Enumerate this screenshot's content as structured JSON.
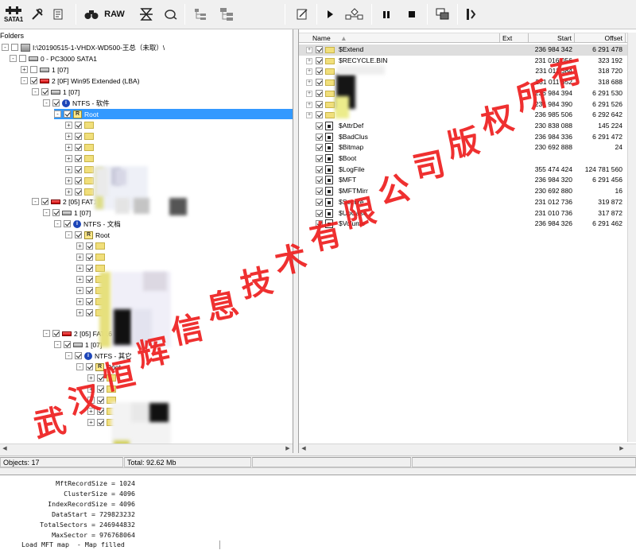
{
  "toolbar": {
    "sata_label": "SATA1",
    "raw_label": "RAW"
  },
  "left": {
    "title": "Folders",
    "tree": [
      {
        "label": "I:\\20190515-1-VHDX-WD500-王总（未取）\\",
        "icon": "pc"
      },
      {
        "label": "0 - PC3000 SATA1",
        "icon": "disk"
      },
      {
        "label": "1 [07]",
        "icon": "disk"
      },
      {
        "label": "2 [0F] Win95 Extended  (LBA)",
        "icon": "part"
      },
      {
        "label": "1 [07]",
        "icon": "disk"
      },
      {
        "label": "NTFS - 软件",
        "icon": "ntfs"
      },
      {
        "label": "Root",
        "icon": "root"
      },
      {
        "label": "2 [05] FAT16 Extended",
        "icon": "part"
      },
      {
        "label": "1 [07]",
        "icon": "disk"
      },
      {
        "label": "NTFS - 文档",
        "icon": "ntfs"
      },
      {
        "label": "Root",
        "icon": "root"
      },
      {
        "label": "2 [05] FAT16 Extended",
        "icon": "part"
      },
      {
        "label": "1 [07]",
        "icon": "disk"
      },
      {
        "label": "NTFS - 其它",
        "icon": "ntfs"
      },
      {
        "label": "Root",
        "icon": "root"
      }
    ]
  },
  "right": {
    "columns": [
      "Name",
      "Ext",
      "Start",
      "Offset"
    ],
    "rows": [
      {
        "name": "$Extend",
        "start": "236 984 342",
        "offset": "6 291 478",
        "type": "folder"
      },
      {
        "name": "$RECYCLE.BIN",
        "start": "231 016 056",
        "offset": "323 192",
        "type": "folder"
      },
      {
        "name": "",
        "start": "231 011 584",
        "offset": "318 720",
        "type": "folder"
      },
      {
        "name": "",
        "start": "231 011 552",
        "offset": "318 688",
        "type": "folder"
      },
      {
        "name": "",
        "start": "236 984 394",
        "offset": "6 291 530",
        "type": "folder"
      },
      {
        "name": "",
        "start": "236 984 390",
        "offset": "6 291 526",
        "type": "folder"
      },
      {
        "name": "",
        "start": "236 985 506",
        "offset": "6 292 642",
        "type": "folder"
      },
      {
        "name": "$AttrDef",
        "start": "230 838 088",
        "offset": "145 224",
        "type": "file"
      },
      {
        "name": "$BadClus",
        "start": "236 984 336",
        "offset": "6 291 472",
        "type": "file"
      },
      {
        "name": "$Bitmap",
        "start": "230 692 888",
        "offset": "24",
        "type": "file"
      },
      {
        "name": "$Boot",
        "start": "",
        "offset": "",
        "type": "file"
      },
      {
        "name": "$LogFile",
        "start": "355 474 424",
        "offset": "124 781 560",
        "type": "file"
      },
      {
        "name": "$MFT",
        "start": "236 984 320",
        "offset": "6 291 456",
        "type": "file"
      },
      {
        "name": "$MFTMirr",
        "start": "230 692 880",
        "offset": "16",
        "type": "file"
      },
      {
        "name": "$Secure",
        "start": "231 012 736",
        "offset": "319 872",
        "type": "file"
      },
      {
        "name": "$UpCase",
        "start": "231 010 736",
        "offset": "317 872",
        "type": "file"
      },
      {
        "name": "$Volume",
        "start": "236 984 326",
        "offset": "6 291 462",
        "type": "file"
      }
    ]
  },
  "status": {
    "objects": "Objects: 17",
    "total": "Total: 92.62 Mb"
  },
  "log": [
    {
      "key": "MftRecordSize",
      "value": "1024"
    },
    {
      "key": "ClusterSize",
      "value": "4096"
    },
    {
      "key": "IndexRecordSize",
      "value": "4096"
    },
    {
      "key": "DataStart",
      "value": "729823232"
    },
    {
      "key": "TotalSectors",
      "value": "246944832"
    },
    {
      "key": "MaxSector",
      "value": "976768064"
    }
  ],
  "log_last": "Load MFT map  - Map filled",
  "watermark": "武汉恒辉信息技术有限公司版权所有"
}
